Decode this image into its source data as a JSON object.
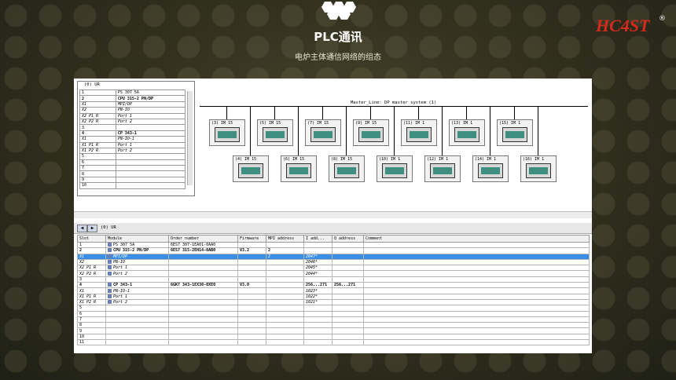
{
  "header": {
    "title": "PLC通讯",
    "subtitle": "电炉主体通信网络的组态",
    "brand_text": "HC4ST",
    "brand_mark": "®"
  },
  "rack": {
    "title": "(0) UR",
    "rows": [
      {
        "slot": "1",
        "module": "PS 307 5A"
      },
      {
        "slot": "2",
        "module": "CPU 315-2 PN/DP"
      },
      {
        "slot": "X1",
        "module": "MPI/DP"
      },
      {
        "slot": "X2",
        "module": "PN-IO"
      },
      {
        "slot": "X2 P1 R",
        "module": "Port 1"
      },
      {
        "slot": "X2 P2 R",
        "module": "Port 2"
      },
      {
        "slot": "3",
        "module": ""
      },
      {
        "slot": "4",
        "module": "CP 343-1"
      },
      {
        "slot": "X1",
        "module": "PN-IO-1"
      },
      {
        "slot": "X1 P1 R",
        "module": "Port 1"
      },
      {
        "slot": "X1 P2 R",
        "module": "Port 2"
      },
      {
        "slot": "5",
        "module": ""
      },
      {
        "slot": "6",
        "module": ""
      },
      {
        "slot": "7",
        "module": ""
      },
      {
        "slot": "8",
        "module": ""
      },
      {
        "slot": "9",
        "module": ""
      },
      {
        "slot": "10",
        "module": ""
      }
    ]
  },
  "network": {
    "master_label": "Master_Line: DP master system (1)",
    "devices_top": [
      "(3) IM 15",
      "(5) IM 15",
      "(7) IM 15",
      "(9) IM 15",
      "(11) IM 1",
      "(13) IM 1",
      "(15) IM 1"
    ],
    "devices_bottom": [
      "(4) IM 15",
      "(6) IM 15",
      "(8) IM 15",
      "(10) IM 1",
      "(12) IM 1",
      "(14) IM 1",
      "(16) IM 1"
    ]
  },
  "detail": {
    "title": "(0)   UR",
    "headers": [
      "Slot",
      "Module",
      "Order number",
      "Firmware",
      "MPI address",
      "I add...",
      "Q address",
      "Comment"
    ],
    "rows": [
      {
        "slot": "1",
        "module": "PS 307 5A",
        "order": "6ES7 307-1EA01-0AA0",
        "fw": "",
        "mpi": "",
        "i": "",
        "q": "",
        "c": "",
        "style": ""
      },
      {
        "slot": "2",
        "module": "CPU 315-2 PN/DP",
        "order": "6ES7 315-2EH14-0AB0",
        "fw": "V3.2",
        "mpi": "2",
        "i": "",
        "q": "",
        "c": "",
        "style": "bold"
      },
      {
        "slot": "X1",
        "module": "MPI/DP",
        "order": "",
        "fw": "",
        "mpi": "2",
        "i": "2047*",
        "q": "",
        "c": "",
        "style": "sel"
      },
      {
        "slot": "X2",
        "module": "PN-IO",
        "order": "",
        "fw": "",
        "mpi": "",
        "i": "2046*",
        "q": "",
        "c": "",
        "style": "sub"
      },
      {
        "slot": "X2 P1 R",
        "module": "Port 1",
        "order": "",
        "fw": "",
        "mpi": "",
        "i": "2045*",
        "q": "",
        "c": "",
        "style": "sub"
      },
      {
        "slot": "X2 P2 R",
        "module": "Port 2",
        "order": "",
        "fw": "",
        "mpi": "",
        "i": "2044*",
        "q": "",
        "c": "",
        "style": "sub"
      },
      {
        "slot": "3",
        "module": "",
        "order": "",
        "fw": "",
        "mpi": "",
        "i": "",
        "q": "",
        "c": "",
        "style": ""
      },
      {
        "slot": "4",
        "module": "CP 343-1",
        "order": "6GK7 343-1EX30-0XE0",
        "fw": "V3.0",
        "mpi": "",
        "i": "256...271",
        "q": "256...271",
        "c": "",
        "style": "bold"
      },
      {
        "slot": "X1",
        "module": "PN-IO-1",
        "order": "",
        "fw": "",
        "mpi": "",
        "i": "1023*",
        "q": "",
        "c": "",
        "style": "sub"
      },
      {
        "slot": "X1 P1 R",
        "module": "Port 1",
        "order": "",
        "fw": "",
        "mpi": "",
        "i": "1022*",
        "q": "",
        "c": "",
        "style": "sub"
      },
      {
        "slot": "X1 P2 R",
        "module": "Port 2",
        "order": "",
        "fw": "",
        "mpi": "",
        "i": "1021*",
        "q": "",
        "c": "",
        "style": "sub"
      },
      {
        "slot": "5",
        "module": "",
        "order": "",
        "fw": "",
        "mpi": "",
        "i": "",
        "q": "",
        "c": "",
        "style": ""
      },
      {
        "slot": "6",
        "module": "",
        "order": "",
        "fw": "",
        "mpi": "",
        "i": "",
        "q": "",
        "c": "",
        "style": ""
      },
      {
        "slot": "7",
        "module": "",
        "order": "",
        "fw": "",
        "mpi": "",
        "i": "",
        "q": "",
        "c": "",
        "style": ""
      },
      {
        "slot": "8",
        "module": "",
        "order": "",
        "fw": "",
        "mpi": "",
        "i": "",
        "q": "",
        "c": "",
        "style": ""
      },
      {
        "slot": "9",
        "module": "",
        "order": "",
        "fw": "",
        "mpi": "",
        "i": "",
        "q": "",
        "c": "",
        "style": ""
      },
      {
        "slot": "10",
        "module": "",
        "order": "",
        "fw": "",
        "mpi": "",
        "i": "",
        "q": "",
        "c": "",
        "style": ""
      },
      {
        "slot": "11",
        "module": "",
        "order": "",
        "fw": "",
        "mpi": "",
        "i": "",
        "q": "",
        "c": "",
        "style": ""
      }
    ]
  },
  "colors": {
    "accent": "#3a8ee6",
    "brand_red": "#d42a1e",
    "module_green": "#3f8f80"
  }
}
